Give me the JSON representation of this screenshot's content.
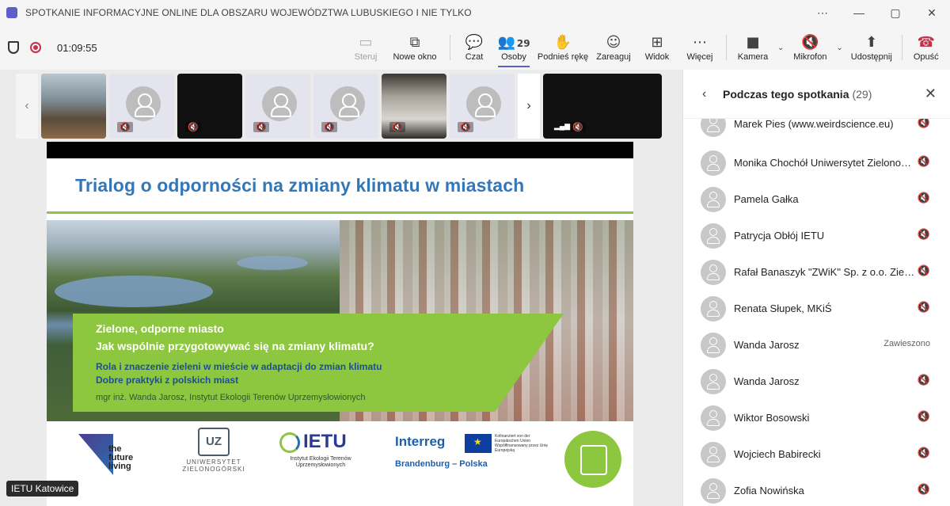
{
  "window": {
    "title": "SPOTKANIE INFORMACYJNE ONLINE DLA OBSZARU WOJEWÓDZTWA LUBUSKIEGO I NIE TYLKO",
    "controls": [
      "⋯",
      "—",
      "▢",
      "✕"
    ]
  },
  "toolbar": {
    "timer": "01:09:55",
    "buttons": {
      "steruj": "Steruj",
      "nowe_okno": "Nowe okno",
      "czat": "Czat",
      "osoby": "Osoby",
      "osoby_count": "29",
      "podnies": "Podnieś rękę",
      "zareaguj": "Zareaguj",
      "widok": "Widok",
      "wiecej": "Więcej",
      "kamera": "Kamera",
      "mikrofon": "Mikrofon",
      "udostepnij": "Udostępnij",
      "opusc": "Opuść"
    },
    "icons": {
      "steruj": "▭",
      "nowe_okno": "⧉",
      "czat": "💬",
      "osoby": "👥",
      "podnies": "✋",
      "zareaguj": "☺",
      "widok": "⊞",
      "wiecej": "⋯",
      "kamera": "■",
      "mikrofon": "🔇",
      "udostepnij": "⬆",
      "opusc": "☎"
    }
  },
  "stage": {
    "label": "IETU Katowice"
  },
  "slide": {
    "title": "Trialog o odporności na zmiany klimatu w miastach",
    "banner_line1": "Zielone, odporne miasto",
    "banner_line2": "Jak wspólnie przygotowywać się na zmiany klimatu?",
    "sub_line1": "Rola i znaczenie zieleni w mieście w adaptacji do zmian klimatu",
    "sub_line2": "Dobre praktyki z polskich miast",
    "author": "mgr inż. Wanda Jarosz, Instytut Ekologii Terenów Uprzemysłowionych",
    "logos": {
      "future": "the future living",
      "uz_mark": "UZ",
      "uz": "UNIWERSYTET ZIELONOGÓRSKI",
      "ietu": "IETU",
      "ietu_sub": "Instytut Ekologii Terenów Uprzemysłowionych",
      "interreg": "Interreg",
      "eu_text": "Kofinanziert von der Europäischen Union Współfinansowany przez Unię Europejską",
      "bp": "Brandenburg – Polska"
    }
  },
  "panel": {
    "title": "Podczas tego spotkania",
    "count": "(29)",
    "participants": [
      {
        "name": "Marek Pies (www.weirdscience.eu)",
        "status": ""
      },
      {
        "name": "Monika Chochół Uniwersytet Zielonogórski",
        "status": ""
      },
      {
        "name": "Pamela Gałka",
        "status": ""
      },
      {
        "name": "Patrycja Obłój IETU",
        "status": ""
      },
      {
        "name": "Rafał Banaszyk \"ZWiK\" Sp. z o.o. Zielona Góra",
        "status": ""
      },
      {
        "name": "Renata Słupek, MKiŚ",
        "status": ""
      },
      {
        "name": "Wanda Jarosz",
        "status": "Zawieszono"
      },
      {
        "name": "Wanda Jarosz",
        "status": ""
      },
      {
        "name": "Wiktor Bosowski",
        "status": ""
      },
      {
        "name": "Wojciech Babirecki",
        "status": ""
      },
      {
        "name": "Zofia Nowińska",
        "status": ""
      }
    ]
  }
}
